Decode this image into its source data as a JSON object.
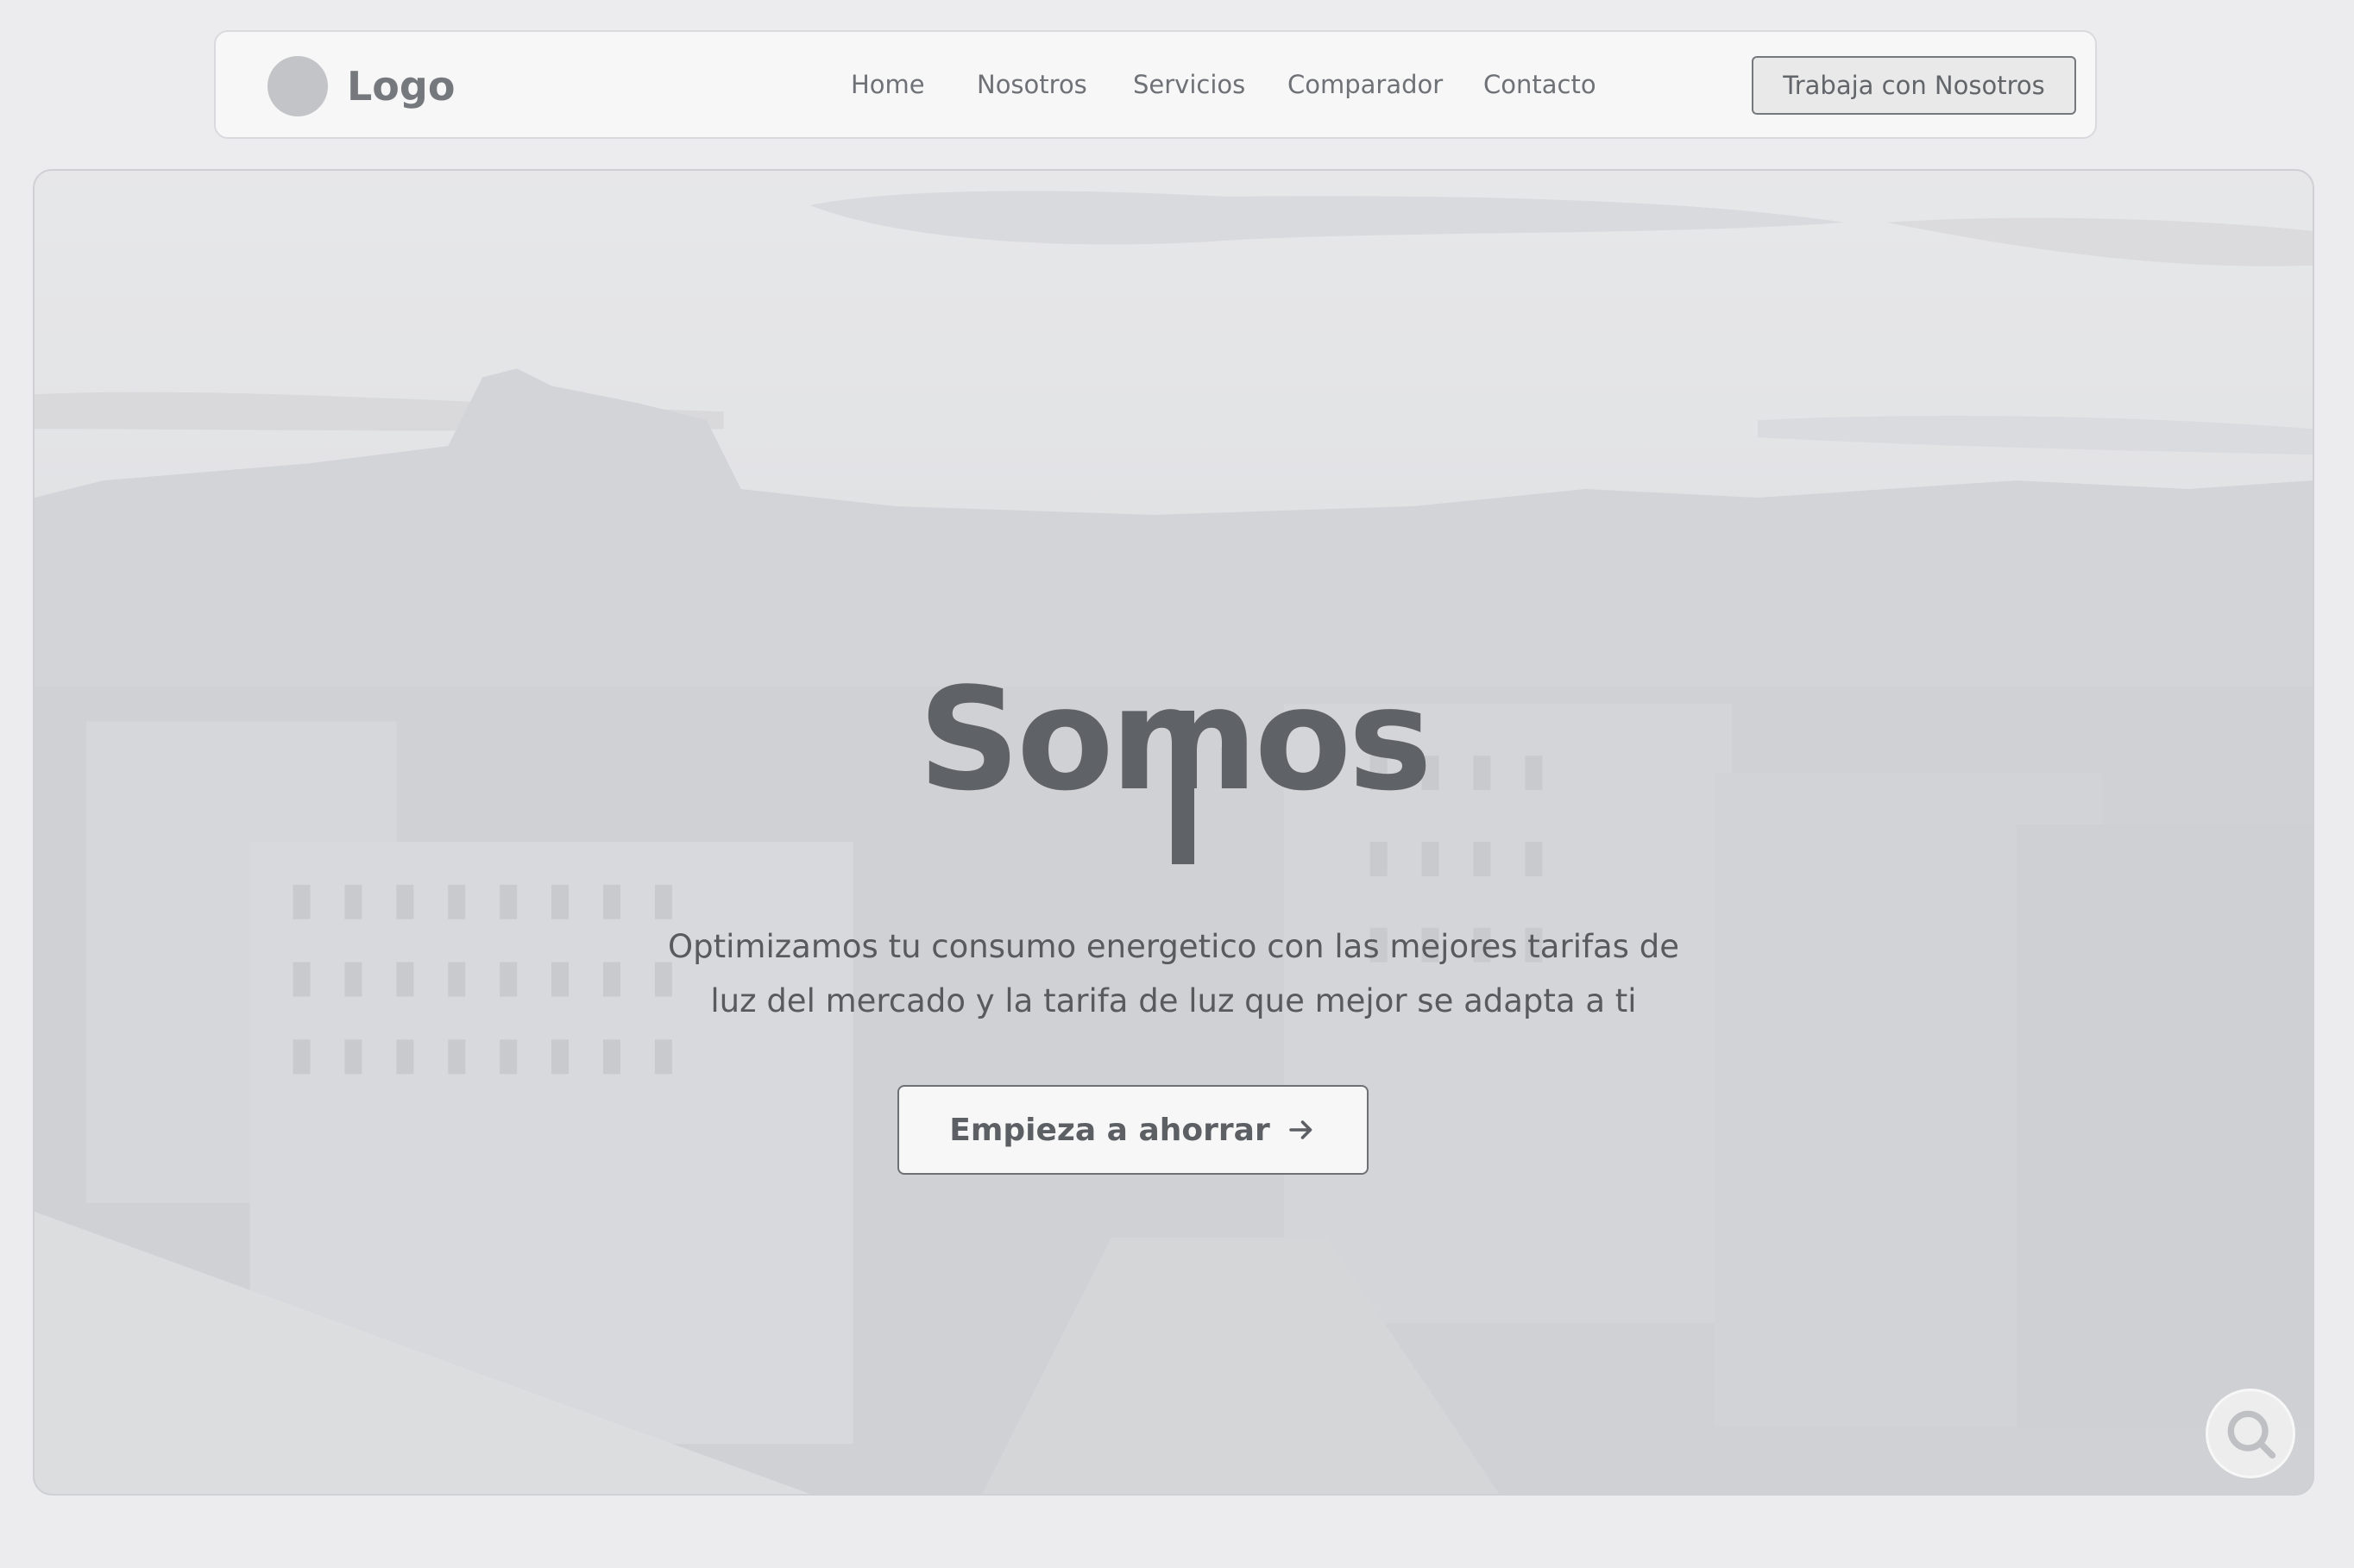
{
  "header": {
    "logo_text": "Logo",
    "nav": [
      "Home",
      "Nosotros",
      "Servicios",
      "Comparador",
      "Contacto"
    ],
    "cta_label": "Trabaja con Nosotros"
  },
  "hero": {
    "title": "Somos",
    "subtitle_line1": "Optimizamos tu consumo energetico con las mejores tarifas de",
    "subtitle_line2": "luz del mercado y la tarifa de luz que mejor se adapta a ti",
    "cta_label": "Empieza a ahorrar",
    "cta_icon": "arrow-right-icon",
    "background": "city-skyline-image",
    "floating_button_icon": "search-icon"
  },
  "colors": {
    "page_bg": "#ececee",
    "navbar_bg": "#f7f7f8",
    "text_dark": "#5f6266",
    "text_muted": "#6e7176"
  }
}
